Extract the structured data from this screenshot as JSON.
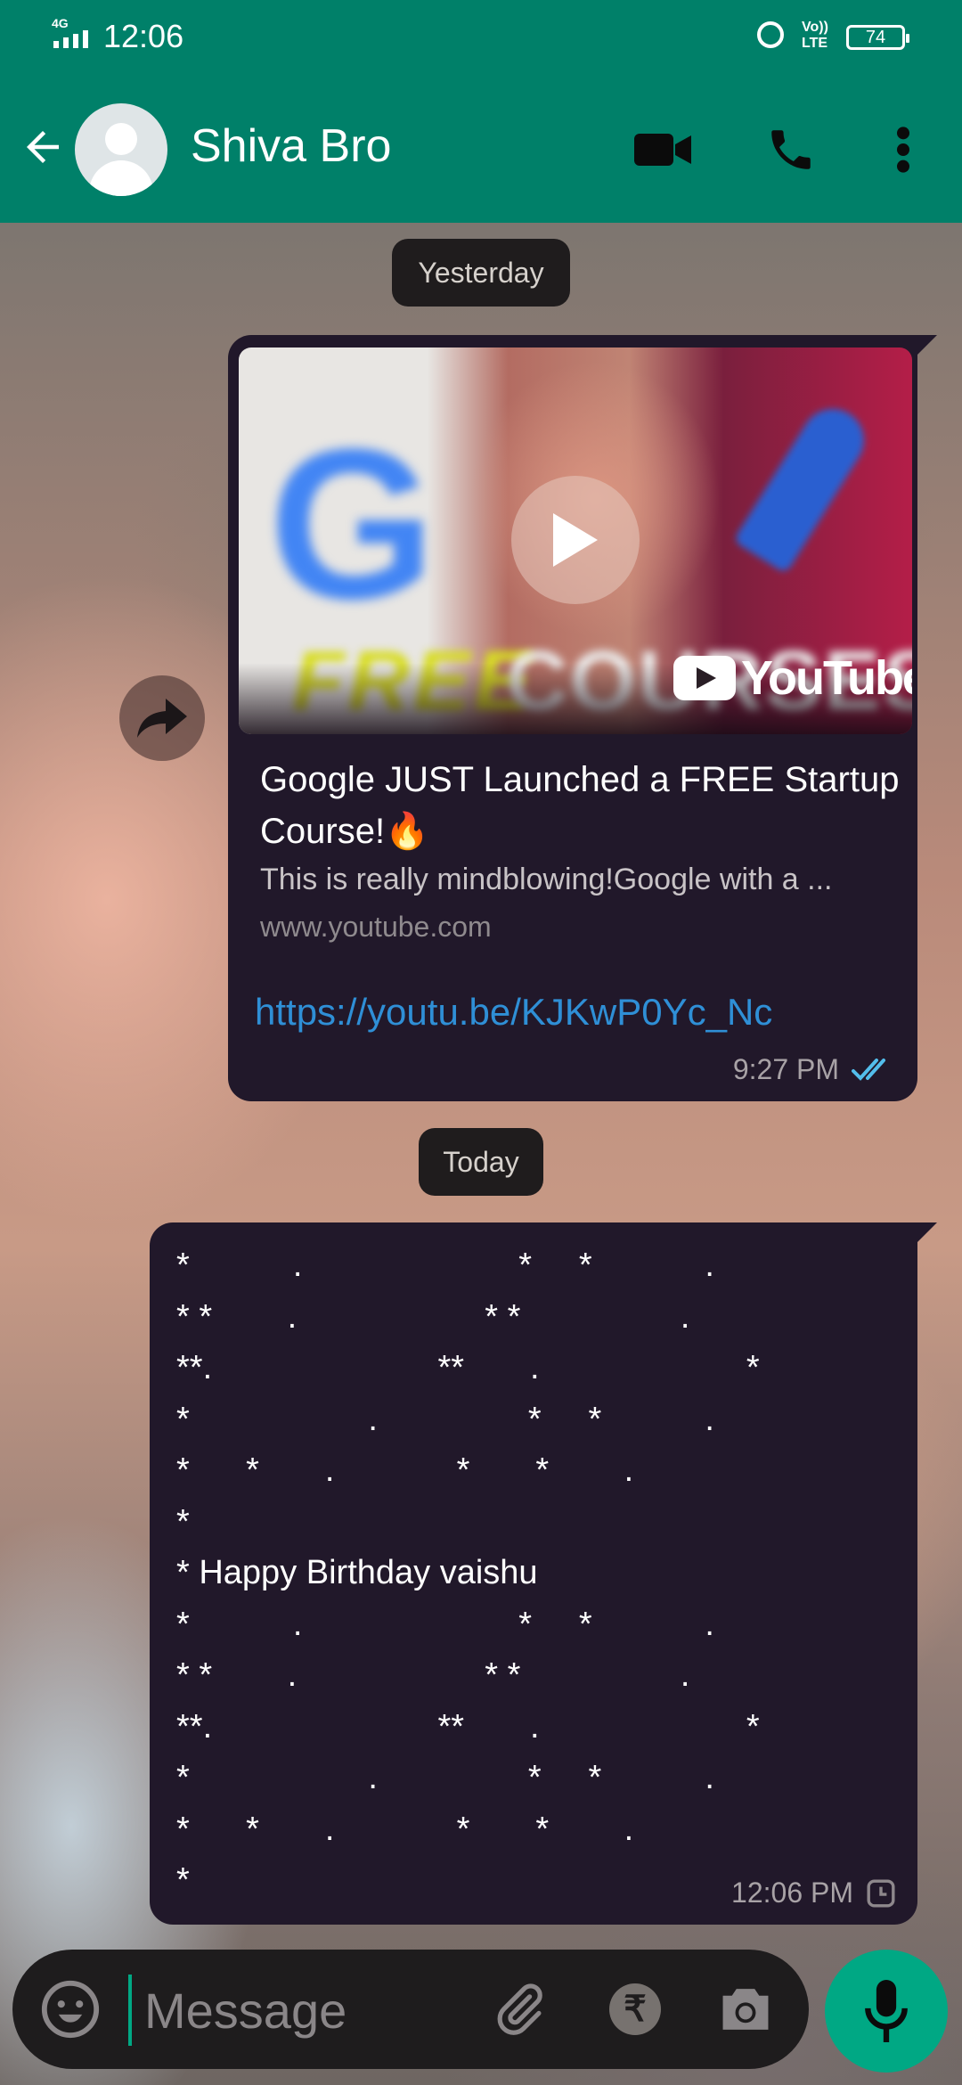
{
  "status_bar": {
    "network": "4G",
    "time": "12:06",
    "volte": "Vo)) LTE",
    "battery": "74"
  },
  "header": {
    "contact_name": "Shiva Bro",
    "icons": [
      "back-arrow-icon",
      "avatar",
      "video-call-icon",
      "phone-icon",
      "more-vert-icon"
    ]
  },
  "chat": {
    "date_chip_1": "Yesterday",
    "date_chip_2": "Today",
    "link_message": {
      "thumbnail_brand": "YouTube",
      "thumbnail_overlay_1": "FREE",
      "thumbnail_overlay_2": "COURSES",
      "title": "Google JUST Launched a FREE Startup Course!🔥",
      "description": "This is really mindblowing!Google with a ...",
      "domain": "www.youtube.com",
      "url": "https://youtu.be/KJKwP0Yc_Nc",
      "time": "9:27 PM",
      "status": "read",
      "status_color": "#53bdeb"
    },
    "birthday_message": {
      "text": "*           .                       *     *            .\n* *        .                    * *                 .\n**.                        **       .                      *\n*                   .                *     *           .\n*      *       .             *       *        .\n*\n* Happy Birthday vaishu\n*           .                       *     *            .\n* *        .                    * *                 .\n**.                        **       .                      *\n*                   .                *     *           .\n*      *       .             *       *        .\n*",
      "time": "12:06 PM",
      "status": "pending"
    }
  },
  "composer": {
    "placeholder": "Message",
    "icons": [
      "emoji-icon",
      "attach-icon",
      "rupee-payment-icon",
      "camera-icon",
      "mic-icon"
    ]
  },
  "colors": {
    "header": "#008069",
    "bubble": "#21182a",
    "accent": "#00a884",
    "link": "#2f8fd6"
  }
}
